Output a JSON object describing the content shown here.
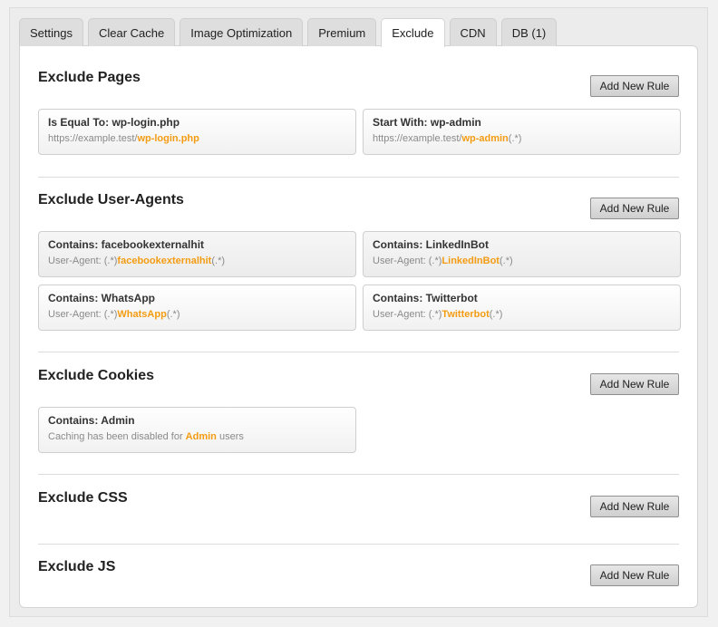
{
  "tabs": [
    "Settings",
    "Clear Cache",
    "Image Optimization",
    "Premium",
    "Exclude",
    "CDN",
    "DB (1)"
  ],
  "active_tab": "Exclude",
  "add_button_label": "Add New Rule",
  "colors": {
    "highlight": "#f39c12",
    "panel_bg": "#ffffff",
    "page_bg": "#f1f1f1"
  },
  "sections": {
    "pages": {
      "title": "Exclude Pages",
      "rules": [
        {
          "title": "Is Equal To: wp-login.php",
          "prefix": "https://example.test/",
          "value": "wp-login.php",
          "suffix": ""
        },
        {
          "title": "Start With: wp-admin",
          "prefix": "https://example.test/",
          "value": "wp-admin",
          "suffix": "(.*)"
        }
      ]
    },
    "user_agents": {
      "title": "Exclude User-Agents",
      "rules": [
        {
          "title": "Contains: facebookexternalhit",
          "prefix": "User-Agent: (.*)",
          "value": "facebookexternalhit",
          "suffix": "(.*)"
        },
        {
          "title": "Contains: LinkedInBot",
          "prefix": "User-Agent: (.*)",
          "value": "LinkedInBot",
          "suffix": "(.*)"
        },
        {
          "title": "Contains: WhatsApp",
          "prefix": "User-Agent: (.*)",
          "value": "WhatsApp",
          "suffix": "(.*)"
        },
        {
          "title": "Contains: Twitterbot",
          "prefix": "User-Agent: (.*)",
          "value": "Twitterbot",
          "suffix": "(.*)"
        }
      ]
    },
    "cookies": {
      "title": "Exclude Cookies",
      "rules": [
        {
          "title": "Contains: Admin",
          "prefix": "Caching has been disabled for ",
          "value": "Admin",
          "suffix": " users"
        }
      ]
    },
    "css": {
      "title": "Exclude CSS"
    },
    "js": {
      "title": "Exclude JS"
    }
  }
}
